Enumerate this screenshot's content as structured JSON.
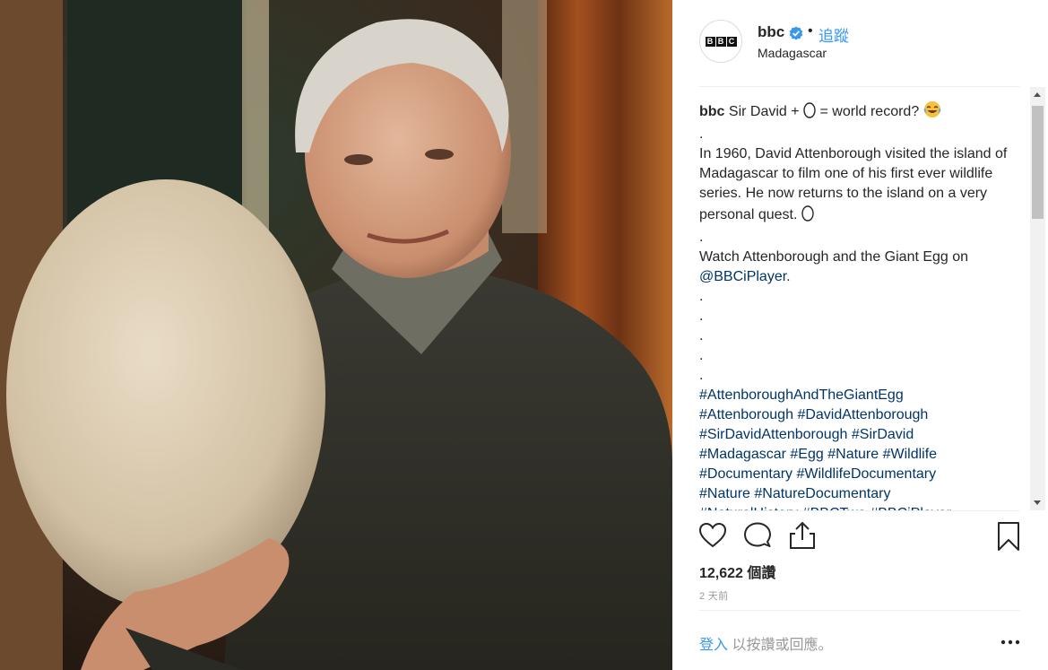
{
  "post": {
    "photo_alt": "bbc photo"
  },
  "header": {
    "username": "bbc",
    "dot": "•",
    "follow_label": "追蹤",
    "location": "Madagascar",
    "avatar_letters": [
      "B",
      "B",
      "C"
    ]
  },
  "caption": {
    "username": "bbc",
    "line1_a": " Sir David + ",
    "line1_b": " = world record? ",
    "dot1": ".",
    "para1": "In 1960, David Attenborough visited the island of Madagascar to film one of his first ever wildlife series. He now returns to the island on a very personal quest. ",
    "dot2": ".",
    "para2_a": "Watch Attenborough and the Giant Egg on ",
    "para2_link": "@BBCiPlayer",
    "para2_b": ".",
    "dots": [
      ".",
      ".",
      ".",
      ".",
      "."
    ],
    "hashtags": [
      [
        "#AttenboroughAndTheGiantEgg"
      ],
      [
        "#Attenborough",
        "#DavidAttenborough"
      ],
      [
        "#SirDavidAttenborough",
        "#SirDavid"
      ],
      [
        "#Madagascar",
        "#Egg",
        "#Nature",
        "#Wildlife"
      ],
      [
        "#Documentary",
        "#WildlifeDocumentary"
      ],
      [
        "#Nature",
        "#NatureDocumentary"
      ],
      [
        "#NaturalHistory",
        "#BBCTwo",
        "#BBCiPlayer"
      ]
    ]
  },
  "stats": {
    "likes": "12,622 個讚",
    "time": "2 天前"
  },
  "comment": {
    "login": "登入",
    "rest": " 以按讚或回應。"
  },
  "icons": {
    "like": "heart-icon",
    "comment": "comment-icon",
    "share": "share-icon",
    "save": "bookmark-icon",
    "more": "more-dots-icon",
    "verified": "verified-badge-icon"
  },
  "colors": {
    "link": "#3897f0",
    "hashtag": "#003569",
    "text": "#262626",
    "muted": "#999999"
  }
}
